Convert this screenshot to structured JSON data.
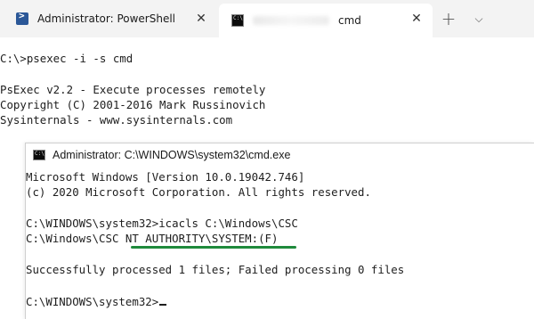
{
  "tabs": [
    {
      "label": "Administrator: PowerShell",
      "icon": "powershell-icon",
      "close": "✕"
    },
    {
      "label": "cmd",
      "icon": "cmd-icon",
      "close": "✕",
      "active": true
    }
  ],
  "tabbar": {
    "new_tab": "+",
    "dropdown": "⌵"
  },
  "outer_terminal": {
    "lines": [
      "C:\\>psexec -i -s cmd",
      "PsExec v2.2 - Execute processes remotely",
      "Copyright (C) 2001-2016 Mark Russinovich",
      "Sysinternals - www.sysinternals.com"
    ]
  },
  "inner_window": {
    "title": "Administrator: C:\\WINDOWS\\system32\\cmd.exe",
    "lines": [
      "Microsoft Windows [Version 10.0.19042.746]",
      "(c) 2020 Microsoft Corporation. All rights reserved.",
      "C:\\WINDOWS\\system32>icacls C:\\Windows\\CSC",
      "C:\\Windows\\CSC NT AUTHORITY\\SYSTEM:(F)",
      "Successfully processed 1 files; Failed processing 0 files",
      "C:\\WINDOWS\\system32>"
    ]
  },
  "colors": {
    "highlight_underline": "#1f8a3c",
    "powershell_blue": "#2b5797"
  }
}
